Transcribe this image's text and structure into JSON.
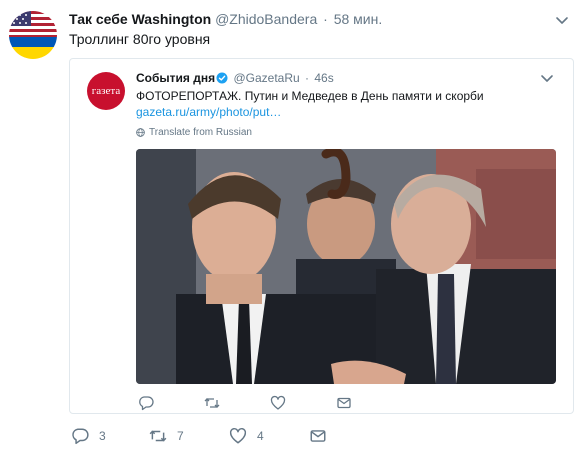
{
  "tweet": {
    "author_name": "Так себе Washington",
    "author_handle": "@ZhidoBandera",
    "separator": "·",
    "time": "58 мин.",
    "text": "Троллинг 80го уровня",
    "icons": [
      "caret-down-icon"
    ]
  },
  "quoted": {
    "avatar_text": "газета",
    "author_name": "События дня",
    "author_handle": "@GazetaRu",
    "separator": "·",
    "time": "46s",
    "text": "ФОТОРЕПОРТАЖ. Путин и Медведев в День памяти и скорби",
    "link": "gazeta.ru/army/photo/put…",
    "translate_label": "Translate from Russian",
    "icons": [
      "verified-badge-icon",
      "globe-icon",
      "caret-down-icon",
      "reply-icon",
      "retweet-icon",
      "like-icon",
      "dm-icon"
    ]
  },
  "actions": {
    "reply_count": "3",
    "retweet_count": "7",
    "like_count": "4",
    "icons": [
      "reply-icon",
      "retweet-icon",
      "like-icon",
      "dm-icon"
    ]
  },
  "colors": {
    "link": "#1b95e0",
    "muted": "#657786",
    "border": "#e1e8ed",
    "avatar_red": "#c8102e",
    "verified": "#1da1f2"
  }
}
